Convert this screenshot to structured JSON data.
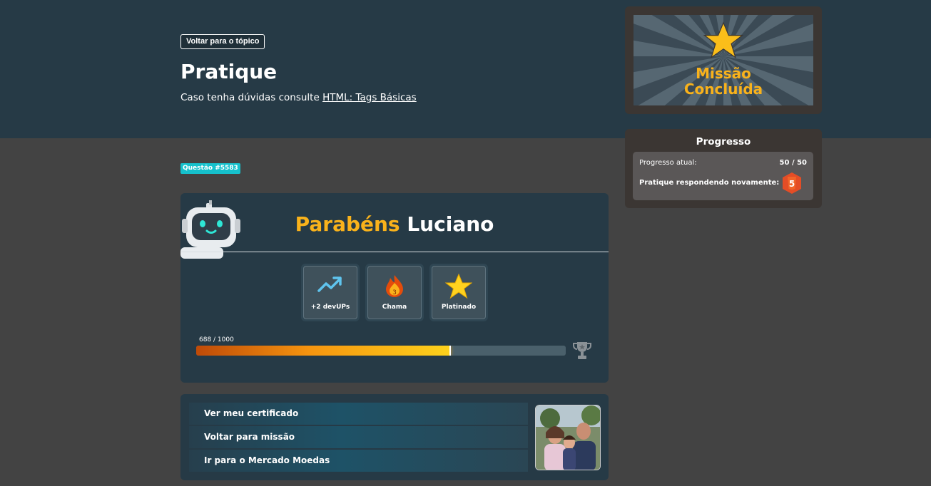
{
  "header": {
    "back_label": "Voltar para o tópico",
    "title": "Pratique",
    "subtitle_prefix": "Caso tenha dúvidas consulte ",
    "subtitle_link": "HTML: Tags Básicas"
  },
  "question": {
    "badge": "Questão #5583"
  },
  "congrats": {
    "greeting": "Parabéns",
    "name": "Luciano",
    "rewards": [
      {
        "icon": "trending-up-icon",
        "label": "+2 devUPs"
      },
      {
        "icon": "flame-icon",
        "label": "Chama",
        "badge_number": "3"
      },
      {
        "icon": "star-icon",
        "label": "Platinado"
      }
    ],
    "xp": {
      "text": "688 / 1000",
      "current": 688,
      "max": 1000
    }
  },
  "actions": {
    "items": [
      "Ver meu certificado",
      "Voltar para missão",
      "Ir para o Mercado Moedas"
    ]
  },
  "mission": {
    "line1": "Missão",
    "line2": "Concluída"
  },
  "progress": {
    "title": "Progresso",
    "current_label": "Progresso atual:",
    "current_value": "50 / 50",
    "again_label": "Pratique respondendo novamente:",
    "html5_digit": "5"
  },
  "colors": {
    "accent": "#f9b21b",
    "header_bg": "#263a46",
    "page_bg": "#434343",
    "badge": "#16c1cc"
  }
}
